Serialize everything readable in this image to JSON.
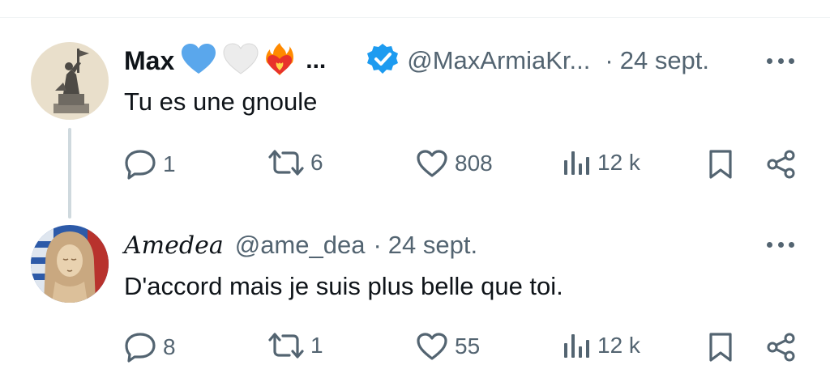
{
  "tweets": [
    {
      "name": "Max",
      "name_emojis": [
        "blue-heart-icon",
        "white-heart-icon",
        "heart-on-fire-icon"
      ],
      "name_ellipsis": "...",
      "verified": true,
      "handle": "@MaxArmiaKr...",
      "separator": "·",
      "date": "24 sept.",
      "text": "Tu es une gnoule",
      "actions": {
        "replies": "1",
        "retweets": "6",
        "likes": "808",
        "views": "12 k"
      }
    },
    {
      "name": "Amedea",
      "handle": "@ame_dea",
      "separator": "·",
      "date": "24 sept.",
      "text": "D'accord mais je suis plus belle que toi.",
      "actions": {
        "replies": "8",
        "retweets": "1",
        "likes": "55",
        "views": "12 k"
      }
    }
  ],
  "colors": {
    "text_primary": "#0f1419",
    "text_secondary": "#536471",
    "verified_blue": "#1d9bf0",
    "thread_line": "#cfd9de",
    "blue_heart": "#5aa7ec",
    "white_heart": "#e6e6e6"
  }
}
